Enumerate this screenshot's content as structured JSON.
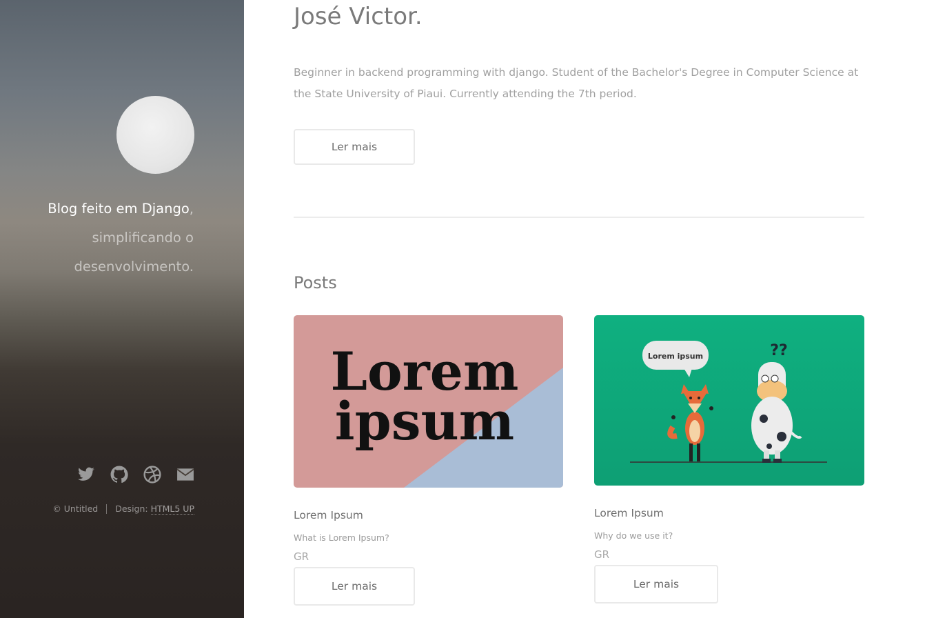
{
  "sidebar": {
    "tagline_strong": "Blog feito em Django",
    "tagline_comma": ",",
    "tagline_rest_1": "simplificando o",
    "tagline_rest_2": "desenvolvimento.",
    "social_icons": [
      "twitter-icon",
      "github-icon",
      "dribbble-icon",
      "envelope-icon"
    ],
    "copyright": "© Untitled",
    "design_label": "Design:",
    "design_link": "HTML5 UP"
  },
  "header": {
    "name": "José Victor.",
    "bio": "Beginner in backend programming with django. Student of the Bachelor's Degree in Computer Science at the State University of Piaui. Currently attending the 7th period.",
    "read_more": "Ler mais"
  },
  "posts": {
    "section_title": "Posts",
    "items": [
      {
        "image_text_1": "Lorem",
        "image_text_2": "ipsum",
        "title": "Lorem Ipsum",
        "subtitle": "What is Lorem Ipsum?",
        "author": "GR",
        "button": "Ler mais"
      },
      {
        "image_bubble": "Lorem ipsum",
        "image_question": "??",
        "title": "Lorem Ipsum",
        "subtitle": "Why do we use it?",
        "author": "GR",
        "button": "Ler mais"
      }
    ]
  },
  "colors": {
    "card1_pink": "#d39a98",
    "card1_blue": "#a9bdd6",
    "card2_green": "#0fae7e"
  }
}
